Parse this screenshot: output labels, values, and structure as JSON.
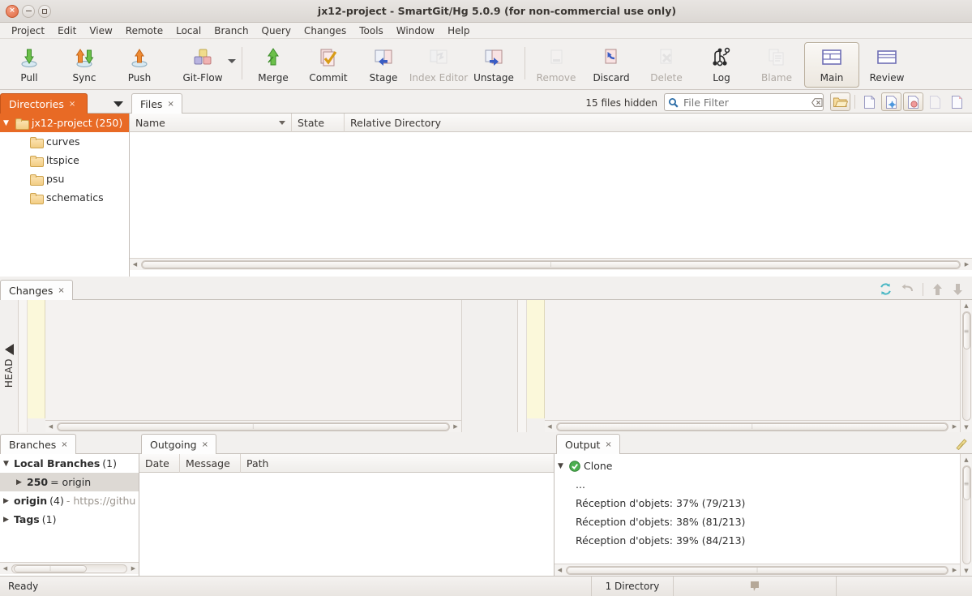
{
  "window": {
    "title": "jx12-project - SmartGit/Hg 5.0.9 (for non-commercial use only)",
    "close_label": "x",
    "minimize_label": "–",
    "maximize_label": "□"
  },
  "menubar": {
    "items": [
      {
        "label": "Project"
      },
      {
        "label": "Edit"
      },
      {
        "label": "View"
      },
      {
        "label": "Remote"
      },
      {
        "label": "Local"
      },
      {
        "label": "Branch"
      },
      {
        "label": "Query"
      },
      {
        "label": "Changes"
      },
      {
        "label": "Tools"
      },
      {
        "label": "Window"
      },
      {
        "label": "Help"
      }
    ]
  },
  "toolbar": {
    "buttons": [
      {
        "label": "Pull",
        "icon": "pull-icon",
        "enabled": true,
        "selected": false,
        "dropdown": false
      },
      {
        "label": "Sync",
        "icon": "sync-icon",
        "enabled": true,
        "selected": false,
        "dropdown": false
      },
      {
        "label": "Push",
        "icon": "push-icon",
        "enabled": true,
        "selected": false,
        "dropdown": false
      },
      {
        "label": "Git-Flow",
        "icon": "git-flow-icon",
        "enabled": true,
        "selected": false,
        "dropdown": true
      },
      {
        "label": "Merge",
        "icon": "merge-icon",
        "enabled": true,
        "selected": false,
        "dropdown": false
      },
      {
        "label": "Commit",
        "icon": "commit-icon",
        "enabled": true,
        "selected": false,
        "dropdown": false
      },
      {
        "label": "Stage",
        "icon": "stage-icon",
        "enabled": true,
        "selected": false,
        "dropdown": false
      },
      {
        "label": "Index Editor",
        "icon": "index-editor-icon",
        "enabled": false,
        "selected": false,
        "dropdown": false
      },
      {
        "label": "Unstage",
        "icon": "unstage-icon",
        "enabled": true,
        "selected": false,
        "dropdown": false
      },
      {
        "label": "Remove",
        "icon": "remove-icon",
        "enabled": false,
        "selected": false,
        "dropdown": false
      },
      {
        "label": "Discard",
        "icon": "discard-icon",
        "enabled": true,
        "selected": false,
        "dropdown": false
      },
      {
        "label": "Delete",
        "icon": "delete-icon",
        "enabled": false,
        "selected": false,
        "dropdown": false
      },
      {
        "label": "Log",
        "icon": "log-icon",
        "enabled": true,
        "selected": false,
        "dropdown": false
      },
      {
        "label": "Blame",
        "icon": "blame-icon",
        "enabled": false,
        "selected": false,
        "dropdown": false
      },
      {
        "label": "Main",
        "icon": "main-view-icon",
        "enabled": true,
        "selected": true,
        "dropdown": false
      },
      {
        "label": "Review",
        "icon": "review-view-icon",
        "enabled": true,
        "selected": false,
        "dropdown": false
      }
    ]
  },
  "directories": {
    "tab_label": "Directories",
    "tab_close": "×",
    "menu_icon": "chevron-down-icon",
    "tree": [
      {
        "label": "jx12-project (250)",
        "level": 0,
        "expanded": true,
        "selected": true,
        "icon": "repo-folder-icon"
      },
      {
        "label": "curves",
        "level": 1,
        "expanded": false,
        "selected": false,
        "icon": "folder-icon"
      },
      {
        "label": "ltspice",
        "level": 1,
        "expanded": false,
        "selected": false,
        "icon": "folder-icon"
      },
      {
        "label": "psu",
        "level": 1,
        "expanded": false,
        "selected": false,
        "icon": "folder-icon"
      },
      {
        "label": "schematics",
        "level": 1,
        "expanded": false,
        "selected": false,
        "icon": "folder-icon"
      }
    ]
  },
  "files": {
    "tab_label": "Files",
    "tab_close": "×",
    "hidden_count_label": "15 files hidden",
    "filter_placeholder": "File Filter",
    "filter_value": "",
    "search_icon": "search-icon",
    "clear_icon": "clear-icon",
    "columns": [
      {
        "label": "Name",
        "sort": "desc"
      },
      {
        "label": "State",
        "sort": ""
      },
      {
        "label": "Relative Directory",
        "sort": ""
      }
    ],
    "rows": [],
    "header_buttons": [
      {
        "icon": "open-folder-icon",
        "enabled": true,
        "pressed": true
      },
      {
        "icon": "file-plain-icon",
        "enabled": true,
        "pressed": false
      },
      {
        "icon": "file-untracked-icon",
        "enabled": true,
        "pressed": true
      },
      {
        "icon": "file-modified-icon",
        "enabled": true,
        "pressed": true
      },
      {
        "icon": "file-ignored-icon",
        "enabled": false,
        "pressed": false
      },
      {
        "icon": "file-other-icon",
        "enabled": true,
        "pressed": false
      }
    ]
  },
  "changes": {
    "tab_label": "Changes",
    "tab_close": "×",
    "head_label": "HEAD",
    "collapse_icon": "triangle-left-icon",
    "toolbar": [
      {
        "icon": "refresh-icon",
        "enabled": true
      },
      {
        "icon": "undo-arrow-icon",
        "enabled": false
      },
      {
        "icon": "up-arrow-icon",
        "enabled": false
      },
      {
        "icon": "down-arrow-icon",
        "enabled": false
      }
    ]
  },
  "branches": {
    "tab_label": "Branches",
    "tab_close": "×",
    "tree": [
      {
        "caret": "▼",
        "bold": "Local Branches",
        "normal": " (1)",
        "level": 0,
        "selected": false
      },
      {
        "caret": "▶",
        "bold": "250",
        "normal": " = origin",
        "level": 1,
        "selected": true
      },
      {
        "caret": "▶",
        "bold": "origin",
        "normal": " (4)",
        "muted": " - https://githu",
        "level": 0,
        "selected": false
      },
      {
        "caret": "▶",
        "bold": "Tags",
        "normal": " (1)",
        "level": 0,
        "selected": false
      }
    ]
  },
  "outgoing": {
    "tab_label": "Outgoing",
    "tab_close": "×",
    "columns": [
      {
        "label": "Date"
      },
      {
        "label": "Message"
      },
      {
        "label": "Path"
      }
    ],
    "rows": []
  },
  "output": {
    "tab_label": "Output",
    "tab_close": "×",
    "edit_icon": "edit-note-icon",
    "group": {
      "caret": "▼",
      "status_icon": "success-check-icon",
      "label": "Clone"
    },
    "lines": [
      "...",
      "Réception d'objets: 37% (79/213)",
      "Réception d'objets: 38% (81/213)",
      "Réception d'objets: 39% (84/213)"
    ]
  },
  "statusbar": {
    "message": "Ready",
    "directory_count": "1 Directory",
    "indicator_icon": "speech-indicator-icon"
  },
  "colors": {
    "accent_orange": "#e86a25",
    "window_bg": "#f2f0ee",
    "panel_bg": "#ffffff",
    "border": "#c3bdb7",
    "diff_marker_yellow": "#fbf8da",
    "success_green": "#3fa93f"
  }
}
